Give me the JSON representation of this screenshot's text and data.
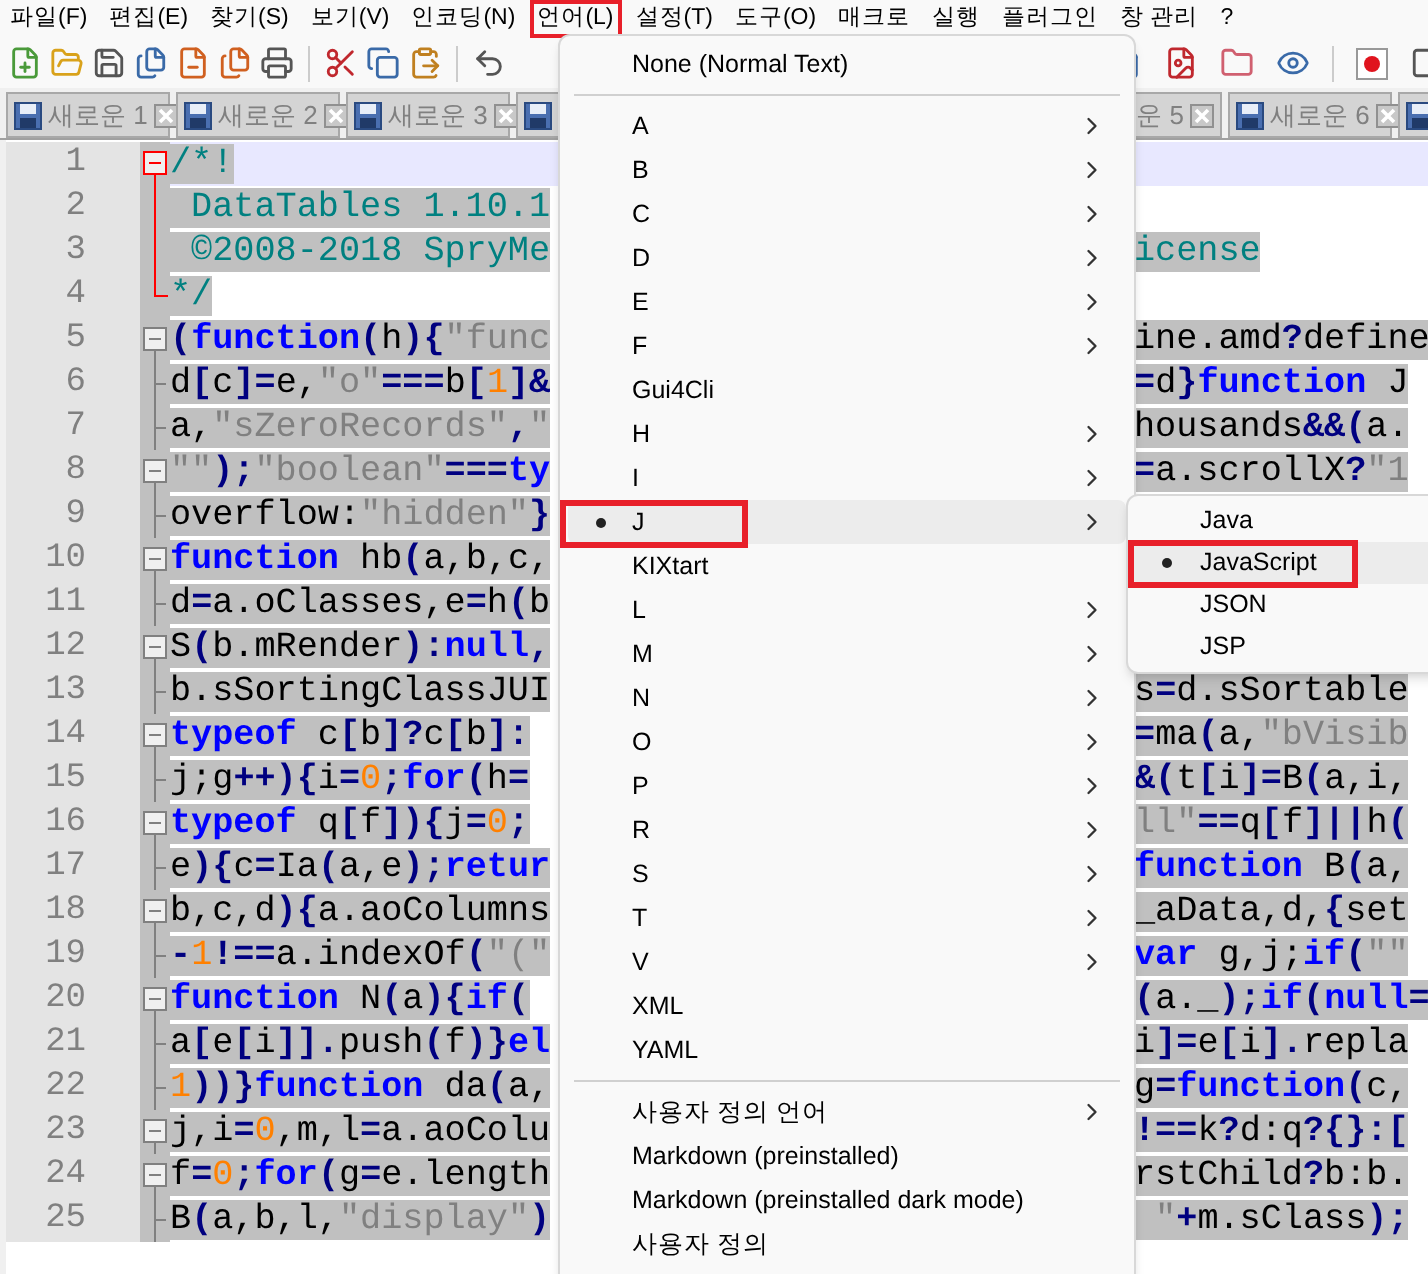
{
  "menubar": [
    {
      "label": "파일(F)",
      "highlighted": false
    },
    {
      "label": "편집(E)",
      "highlighted": false
    },
    {
      "label": "찾기(S)",
      "highlighted": false
    },
    {
      "label": "보기(V)",
      "highlighted": false
    },
    {
      "label": "인코딩(N)",
      "highlighted": false
    },
    {
      "label": "언어(L)",
      "highlighted": true
    },
    {
      "label": "설정(T)",
      "highlighted": false
    },
    {
      "label": "도구(O)",
      "highlighted": false
    },
    {
      "label": "매크로",
      "highlighted": false
    },
    {
      "label": "실행",
      "highlighted": false
    },
    {
      "label": "플러그인",
      "highlighted": false
    },
    {
      "label": "창 관리",
      "highlighted": false
    },
    {
      "label": "?",
      "highlighted": false
    }
  ],
  "tabs": [
    {
      "label": "새로운 1",
      "kind": "full"
    },
    {
      "label": "새로운 2",
      "kind": "full"
    },
    {
      "label": "새로운 3",
      "kind": "full"
    },
    {
      "kind": "hidden"
    },
    {
      "label": "운 5",
      "kind": "cut"
    },
    {
      "label": "새로운 6",
      "kind": "full"
    },
    {
      "kind": "edge"
    }
  ],
  "editor": {
    "lines": [
      {
        "number": "1",
        "kind": "fold-start",
        "fold_highlighted": true,
        "current": true,
        "left": [
          {
            "text": "/*!",
            "kind": "comment"
          }
        ]
      },
      {
        "number": "2",
        "kind": "fold-body",
        "fold_highlighted": true,
        "current": false,
        "left": [
          {
            "text": " DataTables 1.10.1",
            "kind": "comment"
          }
        ]
      },
      {
        "number": "3",
        "kind": "fold-body",
        "fold_highlighted": true,
        "current": false,
        "left": [
          {
            "text": " ©2008-2018 SpryMe",
            "kind": "comment"
          }
        ],
        "right": [
          {
            "text": "icense",
            "kind": "comment"
          }
        ]
      },
      {
        "number": "4",
        "kind": "fold-end",
        "fold_highlighted": true,
        "current": false,
        "left": [
          {
            "text": "*/",
            "kind": "comment"
          }
        ]
      },
      {
        "number": "5",
        "kind": "fold-start",
        "fold_highlighted": false,
        "current": false,
        "left": [
          {
            "text": "(",
            "kind": "operator"
          },
          {
            "text": "function",
            "kind": "keyword"
          },
          {
            "text": "(",
            "kind": "operator"
          },
          {
            "text": "h",
            "kind": "plain"
          },
          {
            "text": "){",
            "kind": "operator"
          },
          {
            "text": "\"func",
            "kind": "string"
          }
        ],
        "right": [
          {
            "text": "ine.amd",
            "kind": "plain"
          },
          {
            "text": "?",
            "kind": "operator"
          },
          {
            "text": "define",
            "kind": "plain"
          }
        ]
      },
      {
        "number": "6",
        "kind": "fold-branch",
        "fold_highlighted": false,
        "current": false,
        "left": [
          {
            "text": "d",
            "kind": "plain"
          },
          {
            "text": "[",
            "kind": "operator"
          },
          {
            "text": "c",
            "kind": "plain"
          },
          {
            "text": "]=",
            "kind": "operator"
          },
          {
            "text": "e,",
            "kind": "plain"
          },
          {
            "text": "\"o\"",
            "kind": "string"
          },
          {
            "text": "===",
            "kind": "operator"
          },
          {
            "text": "b",
            "kind": "plain"
          },
          {
            "text": "[",
            "kind": "operator"
          },
          {
            "text": "1",
            "kind": "number"
          },
          {
            "text": "]&",
            "kind": "operator"
          }
        ],
        "right": [
          {
            "text": "=",
            "kind": "operator"
          },
          {
            "text": "d",
            "kind": "plain"
          },
          {
            "text": "}",
            "kind": "operator"
          },
          {
            "text": "function",
            "kind": "keyword"
          },
          {
            "text": " J",
            "kind": "plain"
          }
        ]
      },
      {
        "number": "7",
        "kind": "fold-branch",
        "fold_highlighted": false,
        "current": false,
        "left": [
          {
            "text": "a,",
            "kind": "plain"
          },
          {
            "text": "\"sZeroRecords\"",
            "kind": "string"
          },
          {
            "text": ",",
            "kind": "operator"
          },
          {
            "text": "\"",
            "kind": "string"
          }
        ],
        "right": [
          {
            "text": "housands",
            "kind": "plain"
          },
          {
            "text": "&&(",
            "kind": "operator"
          },
          {
            "text": "a.",
            "kind": "plain"
          }
        ]
      },
      {
        "number": "8",
        "kind": "fold-start",
        "fold_highlighted": false,
        "current": false,
        "left": [
          {
            "text": "\"\"",
            "kind": "string"
          },
          {
            "text": ");",
            "kind": "operator"
          },
          {
            "text": "\"boolean\"",
            "kind": "string"
          },
          {
            "text": "===",
            "kind": "operator"
          },
          {
            "text": "ty",
            "kind": "keyword"
          }
        ],
        "right": [
          {
            "text": "=",
            "kind": "operator"
          },
          {
            "text": "a.scrollX",
            "kind": "plain"
          },
          {
            "text": "?",
            "kind": "operator"
          },
          {
            "text": "\"1",
            "kind": "string"
          }
        ]
      },
      {
        "number": "9",
        "kind": "fold-branch",
        "fold_highlighted": false,
        "current": false,
        "left": [
          {
            "text": "overflow:",
            "kind": "plain"
          },
          {
            "text": "\"hidden\"",
            "kind": "string"
          },
          {
            "text": "}",
            "kind": "operator"
          }
        ]
      },
      {
        "number": "10",
        "kind": "fold-start",
        "fold_highlighted": false,
        "current": false,
        "left": [
          {
            "text": "function",
            "kind": "keyword"
          },
          {
            "text": " hb",
            "kind": "plain"
          },
          {
            "text": "(",
            "kind": "operator"
          },
          {
            "text": "a,b,c,",
            "kind": "plain"
          }
        ]
      },
      {
        "number": "11",
        "kind": "fold-branch",
        "fold_highlighted": false,
        "current": false,
        "left": [
          {
            "text": "d",
            "kind": "plain"
          },
          {
            "text": "=",
            "kind": "operator"
          },
          {
            "text": "a.oClasses,e",
            "kind": "plain"
          },
          {
            "text": "=",
            "kind": "operator"
          },
          {
            "text": "h",
            "kind": "plain"
          },
          {
            "text": "(",
            "kind": "operator"
          },
          {
            "text": "b",
            "kind": "plain"
          }
        ]
      },
      {
        "number": "12",
        "kind": "fold-start",
        "fold_highlighted": false,
        "current": false,
        "left": [
          {
            "text": "S",
            "kind": "plain"
          },
          {
            "text": "(",
            "kind": "operator"
          },
          {
            "text": "b.mRender",
            "kind": "plain"
          },
          {
            "text": "):",
            "kind": "operator"
          },
          {
            "text": "null",
            "kind": "keyword"
          },
          {
            "text": ",",
            "kind": "operator"
          }
        ]
      },
      {
        "number": "13",
        "kind": "fold-branch",
        "fold_highlighted": false,
        "current": false,
        "left": [
          {
            "text": "b.sSortingClassJUI",
            "kind": "plain"
          }
        ],
        "right": [
          {
            "text": "s",
            "kind": "plain"
          },
          {
            "text": "=",
            "kind": "operator"
          },
          {
            "text": "d.sSortable",
            "kind": "plain"
          }
        ]
      },
      {
        "number": "14",
        "kind": "fold-start",
        "fold_highlighted": false,
        "current": false,
        "left": [
          {
            "text": "typeof",
            "kind": "keyword"
          },
          {
            "text": " c",
            "kind": "plain"
          },
          {
            "text": "[",
            "kind": "operator"
          },
          {
            "text": "b",
            "kind": "plain"
          },
          {
            "text": "]?",
            "kind": "operator"
          },
          {
            "text": "c",
            "kind": "plain"
          },
          {
            "text": "[",
            "kind": "operator"
          },
          {
            "text": "b",
            "kind": "plain"
          },
          {
            "text": "]:",
            "kind": "operator"
          }
        ],
        "right": [
          {
            "text": "=",
            "kind": "operator"
          },
          {
            "text": "ma",
            "kind": "plain"
          },
          {
            "text": "(",
            "kind": "operator"
          },
          {
            "text": "a,",
            "kind": "plain"
          },
          {
            "text": "\"bVisib",
            "kind": "string"
          }
        ]
      },
      {
        "number": "15",
        "kind": "fold-branch",
        "fold_highlighted": false,
        "current": false,
        "left": [
          {
            "text": "j;g",
            "kind": "plain"
          },
          {
            "text": "++){",
            "kind": "operator"
          },
          {
            "text": "i",
            "kind": "plain"
          },
          {
            "text": "=",
            "kind": "operator"
          },
          {
            "text": "0",
            "kind": "number"
          },
          {
            "text": ";",
            "kind": "operator"
          },
          {
            "text": "for",
            "kind": "keyword"
          },
          {
            "text": "(",
            "kind": "operator"
          },
          {
            "text": "h",
            "kind": "plain"
          },
          {
            "text": "=",
            "kind": "operator"
          }
        ],
        "right": [
          {
            "text": "&(",
            "kind": "operator"
          },
          {
            "text": "t",
            "kind": "plain"
          },
          {
            "text": "[",
            "kind": "operator"
          },
          {
            "text": "i",
            "kind": "plain"
          },
          {
            "text": "]=",
            "kind": "operator"
          },
          {
            "text": "B",
            "kind": "plain"
          },
          {
            "text": "(",
            "kind": "operator"
          },
          {
            "text": "a,i,",
            "kind": "plain"
          }
        ]
      },
      {
        "number": "16",
        "kind": "fold-start",
        "fold_highlighted": false,
        "current": false,
        "left": [
          {
            "text": "typeof",
            "kind": "keyword"
          },
          {
            "text": " q",
            "kind": "plain"
          },
          {
            "text": "[",
            "kind": "operator"
          },
          {
            "text": "f",
            "kind": "plain"
          },
          {
            "text": "]){",
            "kind": "operator"
          },
          {
            "text": "j",
            "kind": "plain"
          },
          {
            "text": "=",
            "kind": "operator"
          },
          {
            "text": "0",
            "kind": "number"
          },
          {
            "text": ";",
            "kind": "operator"
          }
        ],
        "right": [
          {
            "text": "ll\"",
            "kind": "string"
          },
          {
            "text": "==",
            "kind": "operator"
          },
          {
            "text": "q",
            "kind": "plain"
          },
          {
            "text": "[",
            "kind": "operator"
          },
          {
            "text": "f",
            "kind": "plain"
          },
          {
            "text": "]||",
            "kind": "operator"
          },
          {
            "text": "h",
            "kind": "plain"
          },
          {
            "text": "(",
            "kind": "operator"
          }
        ]
      },
      {
        "number": "17",
        "kind": "fold-branch",
        "fold_highlighted": false,
        "current": false,
        "left": [
          {
            "text": "e",
            "kind": "plain"
          },
          {
            "text": "){",
            "kind": "operator"
          },
          {
            "text": "c",
            "kind": "plain"
          },
          {
            "text": "=",
            "kind": "operator"
          },
          {
            "text": "Ia",
            "kind": "plain"
          },
          {
            "text": "(",
            "kind": "operator"
          },
          {
            "text": "a,e",
            "kind": "plain"
          },
          {
            "text": ");",
            "kind": "operator"
          },
          {
            "text": "retur",
            "kind": "keyword"
          }
        ],
        "right": [
          {
            "text": "function",
            "kind": "keyword"
          },
          {
            "text": " B",
            "kind": "plain"
          },
          {
            "text": "(",
            "kind": "operator"
          },
          {
            "text": "a,",
            "kind": "plain"
          }
        ]
      },
      {
        "number": "18",
        "kind": "fold-start",
        "fold_highlighted": false,
        "current": false,
        "left": [
          {
            "text": "b,c,d",
            "kind": "plain"
          },
          {
            "text": "){",
            "kind": "operator"
          },
          {
            "text": "a.aoColumns",
            "kind": "plain"
          }
        ],
        "right": [
          {
            "text": "_aData,d,",
            "kind": "plain"
          },
          {
            "text": "{",
            "kind": "operator"
          },
          {
            "text": "set",
            "kind": "plain"
          }
        ]
      },
      {
        "number": "19",
        "kind": "fold-branch",
        "fold_highlighted": false,
        "current": false,
        "left": [
          {
            "text": "-",
            "kind": "operator"
          },
          {
            "text": "1",
            "kind": "number"
          },
          {
            "text": "!==",
            "kind": "operator"
          },
          {
            "text": "a.indexOf",
            "kind": "plain"
          },
          {
            "text": "(",
            "kind": "operator"
          },
          {
            "text": "\"(\"",
            "kind": "string"
          }
        ],
        "right": [
          {
            "text": "var",
            "kind": "keyword"
          },
          {
            "text": " g,j;",
            "kind": "plain"
          },
          {
            "text": "if",
            "kind": "keyword"
          },
          {
            "text": "(",
            "kind": "operator"
          },
          {
            "text": "\"\"",
            "kind": "string"
          }
        ]
      },
      {
        "number": "20",
        "kind": "fold-start",
        "fold_highlighted": false,
        "current": false,
        "left": [
          {
            "text": "function",
            "kind": "keyword"
          },
          {
            "text": " N",
            "kind": "plain"
          },
          {
            "text": "(",
            "kind": "operator"
          },
          {
            "text": "a",
            "kind": "plain"
          },
          {
            "text": "){",
            "kind": "operator"
          },
          {
            "text": "if",
            "kind": "keyword"
          },
          {
            "text": "(",
            "kind": "operator"
          }
        ],
        "right": [
          {
            "text": "(",
            "kind": "operator"
          },
          {
            "text": "a._",
            "kind": "plain"
          },
          {
            "text": ");",
            "kind": "operator"
          },
          {
            "text": "if",
            "kind": "keyword"
          },
          {
            "text": "(",
            "kind": "operator"
          },
          {
            "text": "null",
            "kind": "keyword"
          },
          {
            "text": "=",
            "kind": "operator"
          }
        ]
      },
      {
        "number": "21",
        "kind": "fold-branch",
        "fold_highlighted": false,
        "current": false,
        "left": [
          {
            "text": "a",
            "kind": "plain"
          },
          {
            "text": "[",
            "kind": "operator"
          },
          {
            "text": "e",
            "kind": "plain"
          },
          {
            "text": "[",
            "kind": "operator"
          },
          {
            "text": "i",
            "kind": "plain"
          },
          {
            "text": "]].",
            "kind": "operator"
          },
          {
            "text": "push",
            "kind": "plain"
          },
          {
            "text": "(",
            "kind": "operator"
          },
          {
            "text": "f",
            "kind": "plain"
          },
          {
            "text": ")}",
            "kind": "operator"
          },
          {
            "text": "el",
            "kind": "keyword"
          }
        ],
        "right": [
          {
            "text": "i",
            "kind": "plain"
          },
          {
            "text": "]=",
            "kind": "operator"
          },
          {
            "text": "e",
            "kind": "plain"
          },
          {
            "text": "[",
            "kind": "operator"
          },
          {
            "text": "i",
            "kind": "plain"
          },
          {
            "text": "].",
            "kind": "operator"
          },
          {
            "text": "repla",
            "kind": "plain"
          }
        ]
      },
      {
        "number": "22",
        "kind": "fold-branch",
        "fold_highlighted": false,
        "current": false,
        "left": [
          {
            "text": "1",
            "kind": "number"
          },
          {
            "text": "))}",
            "kind": "operator"
          },
          {
            "text": "function",
            "kind": "keyword"
          },
          {
            "text": " da",
            "kind": "plain"
          },
          {
            "text": "(",
            "kind": "operator"
          },
          {
            "text": "a,",
            "kind": "plain"
          }
        ],
        "right": [
          {
            "text": "g",
            "kind": "plain"
          },
          {
            "text": "=",
            "kind": "operator"
          },
          {
            "text": "function",
            "kind": "keyword"
          },
          {
            "text": "(",
            "kind": "operator"
          },
          {
            "text": "c,",
            "kind": "plain"
          }
        ]
      },
      {
        "number": "23",
        "kind": "fold-start",
        "fold_highlighted": false,
        "current": false,
        "left": [
          {
            "text": "j,i",
            "kind": "plain"
          },
          {
            "text": "=",
            "kind": "operator"
          },
          {
            "text": "0",
            "kind": "number"
          },
          {
            "text": ",m,l",
            "kind": "plain"
          },
          {
            "text": "=",
            "kind": "operator"
          },
          {
            "text": "a.aoColu",
            "kind": "plain"
          }
        ],
        "right": [
          {
            "text": "!==",
            "kind": "operator"
          },
          {
            "text": "k",
            "kind": "plain"
          },
          {
            "text": "?",
            "kind": "operator"
          },
          {
            "text": "d:q",
            "kind": "plain"
          },
          {
            "text": "?{}:[",
            "kind": "operator"
          }
        ]
      },
      {
        "number": "24",
        "kind": "fold-start",
        "fold_highlighted": false,
        "current": false,
        "left": [
          {
            "text": "f",
            "kind": "plain"
          },
          {
            "text": "=",
            "kind": "operator"
          },
          {
            "text": "0",
            "kind": "number"
          },
          {
            "text": ";",
            "kind": "operator"
          },
          {
            "text": "for",
            "kind": "keyword"
          },
          {
            "text": "(",
            "kind": "operator"
          },
          {
            "text": "g",
            "kind": "plain"
          },
          {
            "text": "=",
            "kind": "operator"
          },
          {
            "text": "e.length",
            "kind": "plain"
          }
        ],
        "right": [
          {
            "text": "rstChild",
            "kind": "plain"
          },
          {
            "text": "?",
            "kind": "operator"
          },
          {
            "text": "b:b.",
            "kind": "plain"
          }
        ]
      },
      {
        "number": "25",
        "kind": "fold-branch",
        "fold_highlighted": false,
        "current": false,
        "left": [
          {
            "text": "B",
            "kind": "plain"
          },
          {
            "text": "(",
            "kind": "operator"
          },
          {
            "text": "a,b,l,",
            "kind": "plain"
          },
          {
            "text": "\"display\"",
            "kind": "string"
          },
          {
            "text": ")",
            "kind": "operator"
          }
        ],
        "right": [
          {
            "text": " \"",
            "kind": "string"
          },
          {
            "text": "+",
            "kind": "operator"
          },
          {
            "text": "m.sClass",
            "kind": "plain"
          },
          {
            "text": ");",
            "kind": "operator"
          }
        ]
      }
    ]
  },
  "menu": {
    "items": [
      {
        "kind": "item",
        "label": "None (Normal Text)",
        "submenu": false,
        "checked": false,
        "hovered": false,
        "highlighted": false
      },
      {
        "kind": "separator"
      },
      {
        "kind": "item",
        "label": "A",
        "submenu": true,
        "checked": false,
        "hovered": false,
        "highlighted": false
      },
      {
        "kind": "item",
        "label": "B",
        "submenu": true,
        "checked": false,
        "hovered": false,
        "highlighted": false
      },
      {
        "kind": "item",
        "label": "C",
        "submenu": true,
        "checked": false,
        "hovered": false,
        "highlighted": false
      },
      {
        "kind": "item",
        "label": "D",
        "submenu": true,
        "checked": false,
        "hovered": false,
        "highlighted": false
      },
      {
        "kind": "item",
        "label": "E",
        "submenu": true,
        "checked": false,
        "hovered": false,
        "highlighted": false
      },
      {
        "kind": "item",
        "label": "F",
        "submenu": true,
        "checked": false,
        "hovered": false,
        "highlighted": false
      },
      {
        "kind": "item",
        "label": "Gui4Cli",
        "submenu": false,
        "checked": false,
        "hovered": false,
        "highlighted": false
      },
      {
        "kind": "item",
        "label": "H",
        "submenu": true,
        "checked": false,
        "hovered": false,
        "highlighted": false
      },
      {
        "kind": "item",
        "label": "I",
        "submenu": true,
        "checked": false,
        "hovered": false,
        "highlighted": false
      },
      {
        "kind": "item",
        "label": "J",
        "submenu": true,
        "checked": true,
        "hovered": true,
        "highlighted": true
      },
      {
        "kind": "item",
        "label": "KIXtart",
        "submenu": false,
        "checked": false,
        "hovered": false,
        "highlighted": false
      },
      {
        "kind": "item",
        "label": "L",
        "submenu": true,
        "checked": false,
        "hovered": false,
        "highlighted": false
      },
      {
        "kind": "item",
        "label": "M",
        "submenu": true,
        "checked": false,
        "hovered": false,
        "highlighted": false
      },
      {
        "kind": "item",
        "label": "N",
        "submenu": true,
        "checked": false,
        "hovered": false,
        "highlighted": false
      },
      {
        "kind": "item",
        "label": "O",
        "submenu": true,
        "checked": false,
        "hovered": false,
        "highlighted": false
      },
      {
        "kind": "item",
        "label": "P",
        "submenu": true,
        "checked": false,
        "hovered": false,
        "highlighted": false
      },
      {
        "kind": "item",
        "label": "R",
        "submenu": true,
        "checked": false,
        "hovered": false,
        "highlighted": false
      },
      {
        "kind": "item",
        "label": "S",
        "submenu": true,
        "checked": false,
        "hovered": false,
        "highlighted": false
      },
      {
        "kind": "item",
        "label": "T",
        "submenu": true,
        "checked": false,
        "hovered": false,
        "highlighted": false
      },
      {
        "kind": "item",
        "label": "V",
        "submenu": true,
        "checked": false,
        "hovered": false,
        "highlighted": false
      },
      {
        "kind": "item",
        "label": "XML",
        "submenu": false,
        "checked": false,
        "hovered": false,
        "highlighted": false
      },
      {
        "kind": "item",
        "label": "YAML",
        "submenu": false,
        "checked": false,
        "hovered": false,
        "highlighted": false
      },
      {
        "kind": "separator"
      },
      {
        "kind": "item",
        "label": "사용자 정의 언어",
        "submenu": true,
        "checked": false,
        "hovered": false,
        "highlighted": false
      },
      {
        "kind": "item",
        "label": "Markdown (preinstalled)",
        "submenu": false,
        "checked": false,
        "hovered": false,
        "highlighted": false
      },
      {
        "kind": "item",
        "label": "Markdown (preinstalled dark mode)",
        "submenu": false,
        "checked": false,
        "hovered": false,
        "highlighted": false
      },
      {
        "kind": "item",
        "label": "사용자 정의",
        "submenu": false,
        "checked": false,
        "hovered": false,
        "highlighted": false
      }
    ]
  },
  "submenu": {
    "items": [
      {
        "label": "Java",
        "checked": false,
        "hovered": false,
        "highlighted": false
      },
      {
        "label": "JavaScript",
        "checked": true,
        "hovered": true,
        "highlighted": true
      },
      {
        "label": "JSON",
        "checked": false,
        "hovered": false,
        "highlighted": false
      },
      {
        "label": "JSP",
        "checked": false,
        "hovered": false,
        "highlighted": false
      }
    ]
  }
}
